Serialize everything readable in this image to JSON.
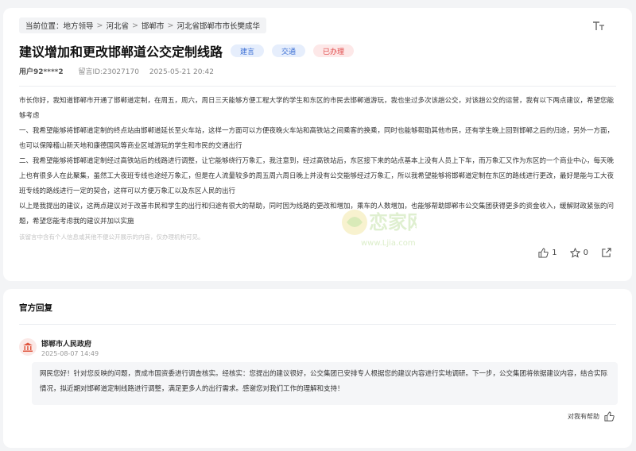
{
  "breadcrumb": {
    "prefix": "当前位置：",
    "items": [
      "地方领导",
      "河北省",
      "邯郸市",
      "河北省邯郸市市长樊成华"
    ]
  },
  "post": {
    "title": "建议增加和更改邯郸道公交定制线路",
    "tags": [
      "建言",
      "交通",
      "已办理"
    ],
    "user": "用户92****2",
    "message_id": "留言ID:23027170",
    "date": "2025-05-21 20:42",
    "paragraphs": [
      "市长你好，我知道邯郸市开通了邯郸道定制，在周五，周六，周日三天能够方便工程大学的学生和东区的市民去邯郸道游玩，我也坐过多次该趟公交，对该趟公交的运营，我有以下两点建议，希望您能够考虑",
      "一、我希望能够将邯郸道定制的终点站由邯郸道延长至火车站，这样一方面可以方便夜晚火车站和高铁站之间乘客的换乘，同时也能够帮助其他市民，还有学生晚上回到邯郸之后的归途，另外一方面，也可以保障稽山新天地和康德国风等商业区域游玩的学生和市民的交通出行",
      "二、我希望能够将邯郸道定制经过高铁站后的线路进行调整，让它能够绕行万象汇，我注意到，经过高铁站后，东区接下来的站点基本上没有人员上下车，而万象汇又作为东区的一个商业中心，每天晚上也有很多人在此聚集，虽然工大夜班专线也途经万象汇，但是在人流量较多的周五周六周日晚上并没有公交能够经过万象汇，所以我希望能够将邯郸道定制在东区的路线进行更改，最好是能与工大夜班专线的路线进行一定的契合，这样可以方便万象汇以及东区人民的出行",
      "以上是我提出的建议，这两点建议对于改善市民和学生的出行和归途有很大的帮助，同时因为线路的更改和增加，乘车的人数增加，也能够帮助邯郸市公交集团获得更多的资金收入，缓解财政紧张的问题，希望您能考虑我的建议并加以实施"
    ],
    "notice": "该留言中含有个人信息或其他不便公开展示的内容，仅办理机构可见。",
    "likes": "1",
    "favorites": "0"
  },
  "reply": {
    "section_title": "官方回复",
    "org_name": "邯郸市人民政府",
    "time": "2025-08-07 14:49",
    "text": "网民您好！针对您反映的问题，责成市国资委进行调查核实。经核实：您提出的建议很好，公交集团已安排专人根据您的建议内容进行实地调研。下一步，公交集团将依据建议内容，结合实际情况，拟近期对邯郸道定制线路进行调整，满足更多人的出行需求。感谢您对我们工作的理解和支持！",
    "helpful_label": "对我有帮助"
  },
  "watermark": {
    "text": "www.Ljia.com"
  },
  "colors": {
    "accent_blue": "#3b6fd4",
    "status_red": "#e04848",
    "page_bg": "#f3f4f6"
  }
}
